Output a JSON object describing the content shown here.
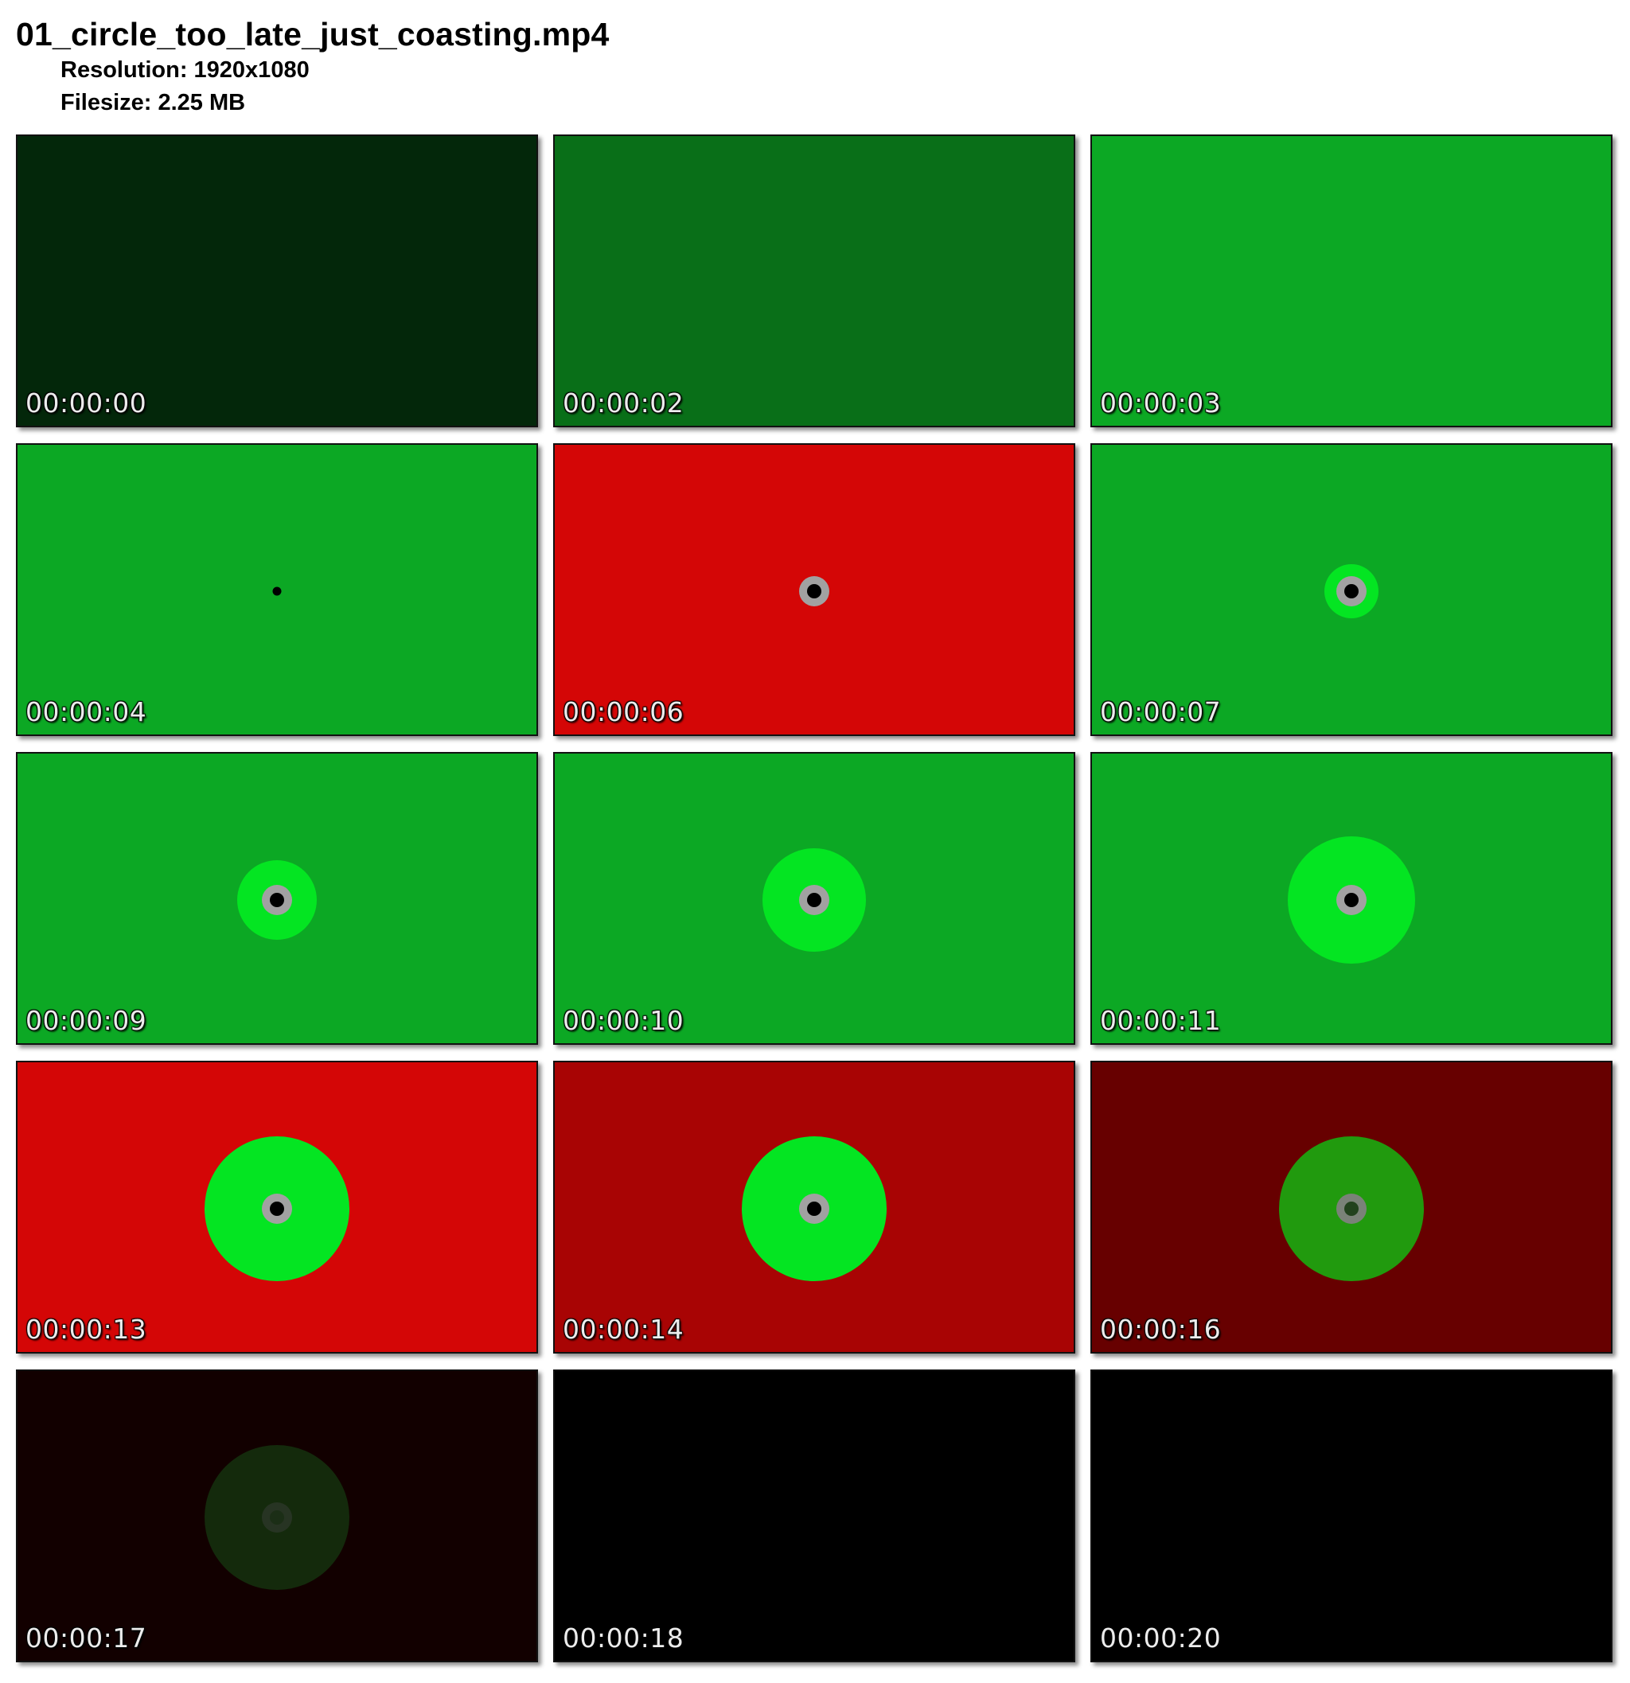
{
  "header": {
    "filename": "01_circle_too_late_just_coasting.mp4",
    "resolution": "Resolution: 1920x1080",
    "filesize": "Filesize: 2.25 MB"
  },
  "frames": [
    {
      "timestamp": "00:00:00",
      "bg": "#03270a",
      "rings": []
    },
    {
      "timestamp": "00:00:02",
      "bg": "#096f18",
      "rings": []
    },
    {
      "timestamp": "00:00:03",
      "bg": "#0ca824",
      "rings": []
    },
    {
      "timestamp": "00:00:04",
      "bg": "#0ca824",
      "rings": [
        {
          "d": 11,
          "color": "#000000"
        }
      ]
    },
    {
      "timestamp": "00:00:06",
      "bg": "#d40606",
      "rings": [
        {
          "d": 38,
          "color": "#a1a1a1"
        },
        {
          "d": 18,
          "color": "#000000"
        }
      ]
    },
    {
      "timestamp": "00:00:07",
      "bg": "#0ca824",
      "rings": [
        {
          "d": 68,
          "color": "#04e522"
        },
        {
          "d": 38,
          "color": "#a1a1a1"
        },
        {
          "d": 18,
          "color": "#000000"
        }
      ]
    },
    {
      "timestamp": "00:00:09",
      "bg": "#0ca824",
      "rings": [
        {
          "d": 100,
          "color": "#04e522"
        },
        {
          "d": 38,
          "color": "#a1a1a1"
        },
        {
          "d": 18,
          "color": "#000000"
        }
      ]
    },
    {
      "timestamp": "00:00:10",
      "bg": "#0ca824",
      "rings": [
        {
          "d": 130,
          "color": "#04e522"
        },
        {
          "d": 38,
          "color": "#a1a1a1"
        },
        {
          "d": 18,
          "color": "#000000"
        }
      ]
    },
    {
      "timestamp": "00:00:11",
      "bg": "#0ca824",
      "rings": [
        {
          "d": 160,
          "color": "#04e522"
        },
        {
          "d": 38,
          "color": "#a1a1a1"
        },
        {
          "d": 18,
          "color": "#000000"
        }
      ]
    },
    {
      "timestamp": "00:00:13",
      "bg": "#d40606",
      "rings": [
        {
          "d": 182,
          "color": "#04e522"
        },
        {
          "d": 38,
          "color": "#a1a1a1"
        },
        {
          "d": 18,
          "color": "#000000"
        }
      ]
    },
    {
      "timestamp": "00:00:14",
      "bg": "#a80404",
      "rings": [
        {
          "d": 182,
          "color": "#04e522"
        },
        {
          "d": 38,
          "color": "#a1a1a1"
        },
        {
          "d": 18,
          "color": "#000000"
        }
      ]
    },
    {
      "timestamp": "00:00:16",
      "bg": "#670000",
      "rings": [
        {
          "d": 182,
          "color": "#219a0e"
        },
        {
          "d": 38,
          "color": "#7a8278"
        },
        {
          "d": 18,
          "color": "#22421d"
        }
      ]
    },
    {
      "timestamp": "00:00:17",
      "bg": "#120000",
      "rings": [
        {
          "d": 182,
          "color": "#142a0c"
        },
        {
          "d": 38,
          "color": "#273423"
        },
        {
          "d": 18,
          "color": "#1b2e16"
        }
      ]
    },
    {
      "timestamp": "00:00:18",
      "bg": "#000000",
      "rings": []
    },
    {
      "timestamp": "00:00:20",
      "bg": "#000000",
      "rings": []
    }
  ]
}
